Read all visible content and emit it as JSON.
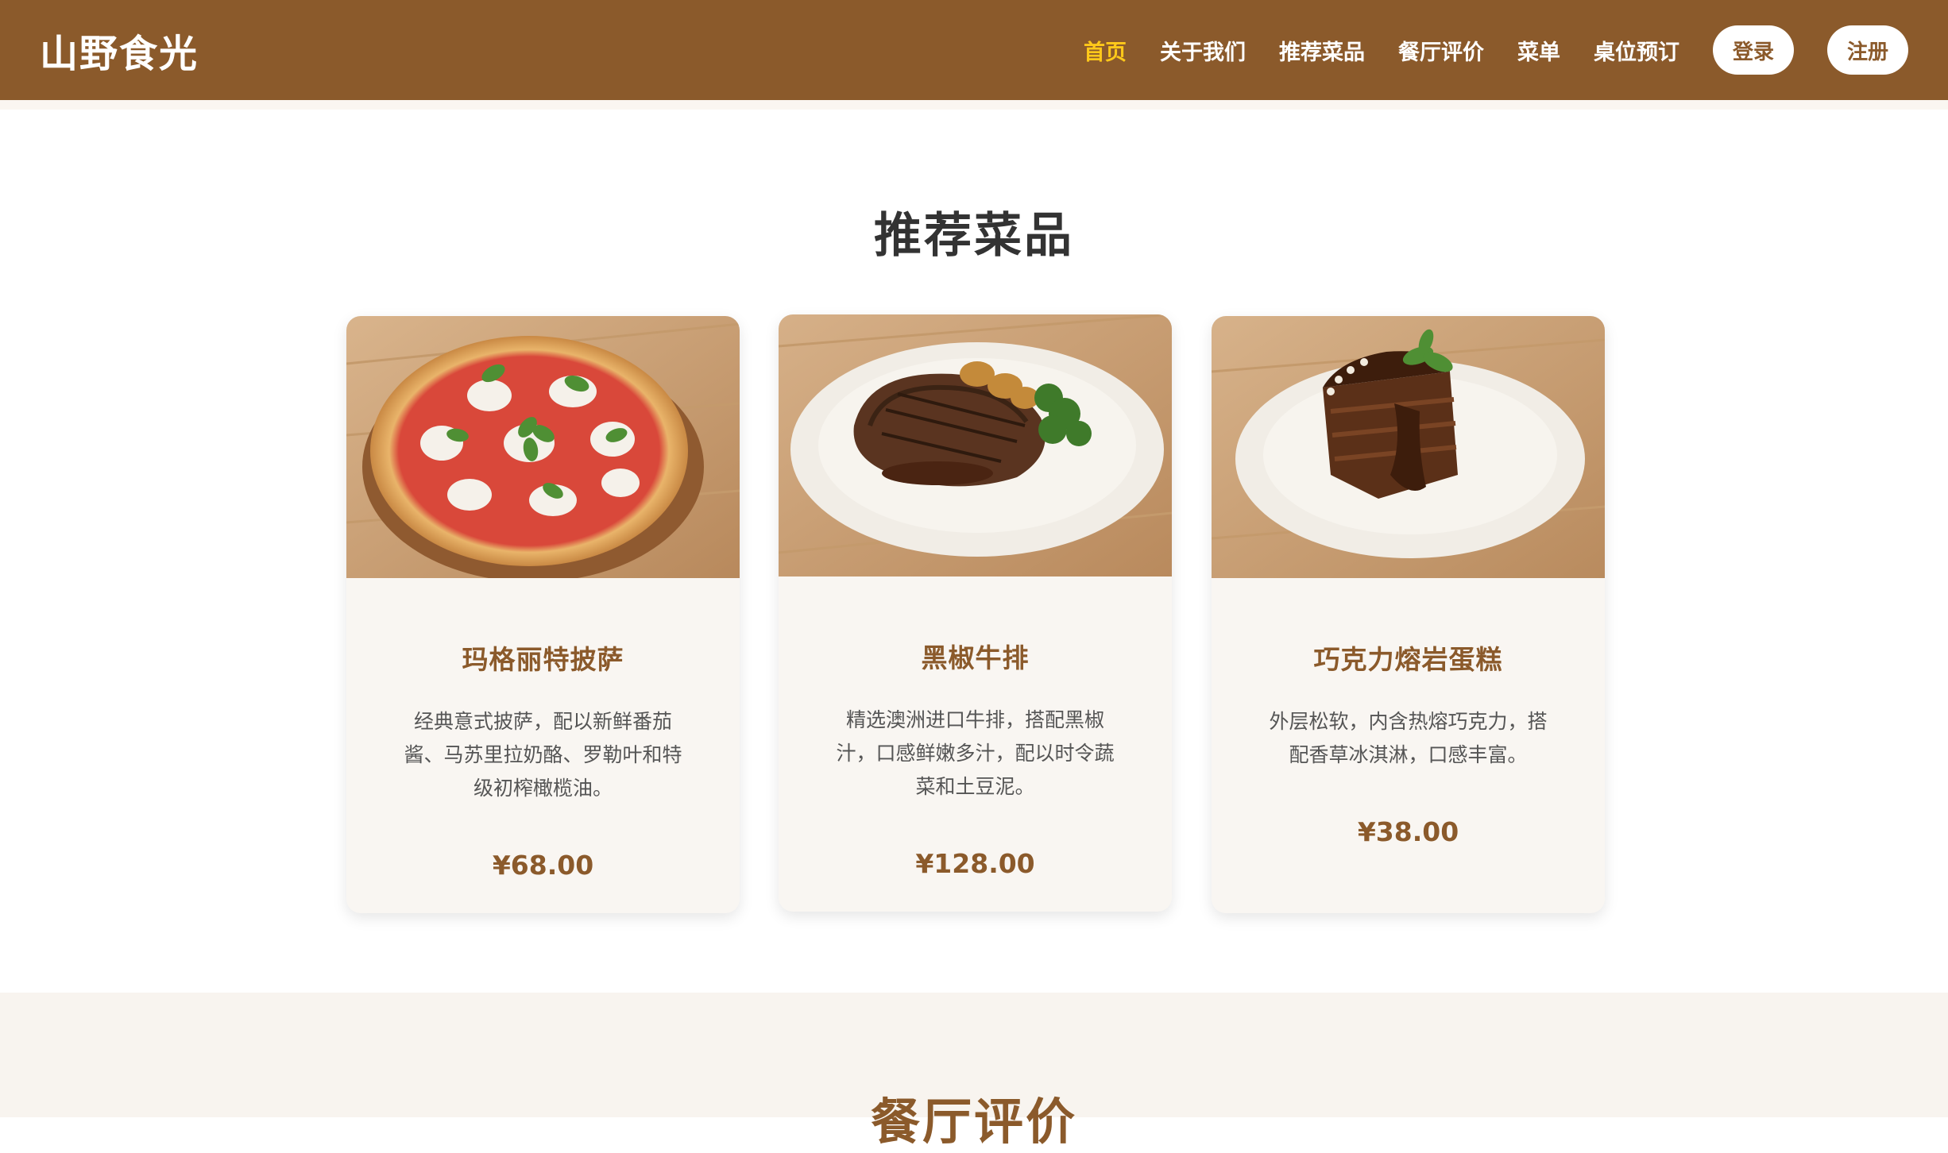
{
  "header": {
    "logo": "山野食光",
    "nav": [
      "首页",
      "关于我们",
      "推荐菜品",
      "餐厅评价",
      "菜单",
      "桌位预订"
    ],
    "login_label": "登录",
    "register_label": "注册"
  },
  "recommended": {
    "title": "推荐菜品",
    "dishes": [
      {
        "name": "玛格丽特披萨",
        "description": "经典意式披萨，配以新鲜番茄酱、马苏里拉奶酪、罗勒叶和特级初榨橄榄油。",
        "price": "¥68.00",
        "image": "pizza-image"
      },
      {
        "name": "黑椒牛排",
        "description": "精选澳洲进口牛排，搭配黑椒汁，口感鲜嫩多汁，配以时令蔬菜和土豆泥。",
        "price": "¥128.00",
        "image": "steak-image"
      },
      {
        "name": "巧克力熔岩蛋糕",
        "description": "外层松软，内含热熔巧克力，搭配香草冰淇淋，口感丰富。",
        "price": "¥38.00",
        "image": "lava-cake-image"
      }
    ]
  },
  "reviews": {
    "title": "餐厅评价"
  },
  "colors": {
    "brand": "#8b5a2b",
    "active_nav": "#ffc91a",
    "card_bg": "#f9f6f2",
    "section_bg": "#f8f4ef"
  }
}
